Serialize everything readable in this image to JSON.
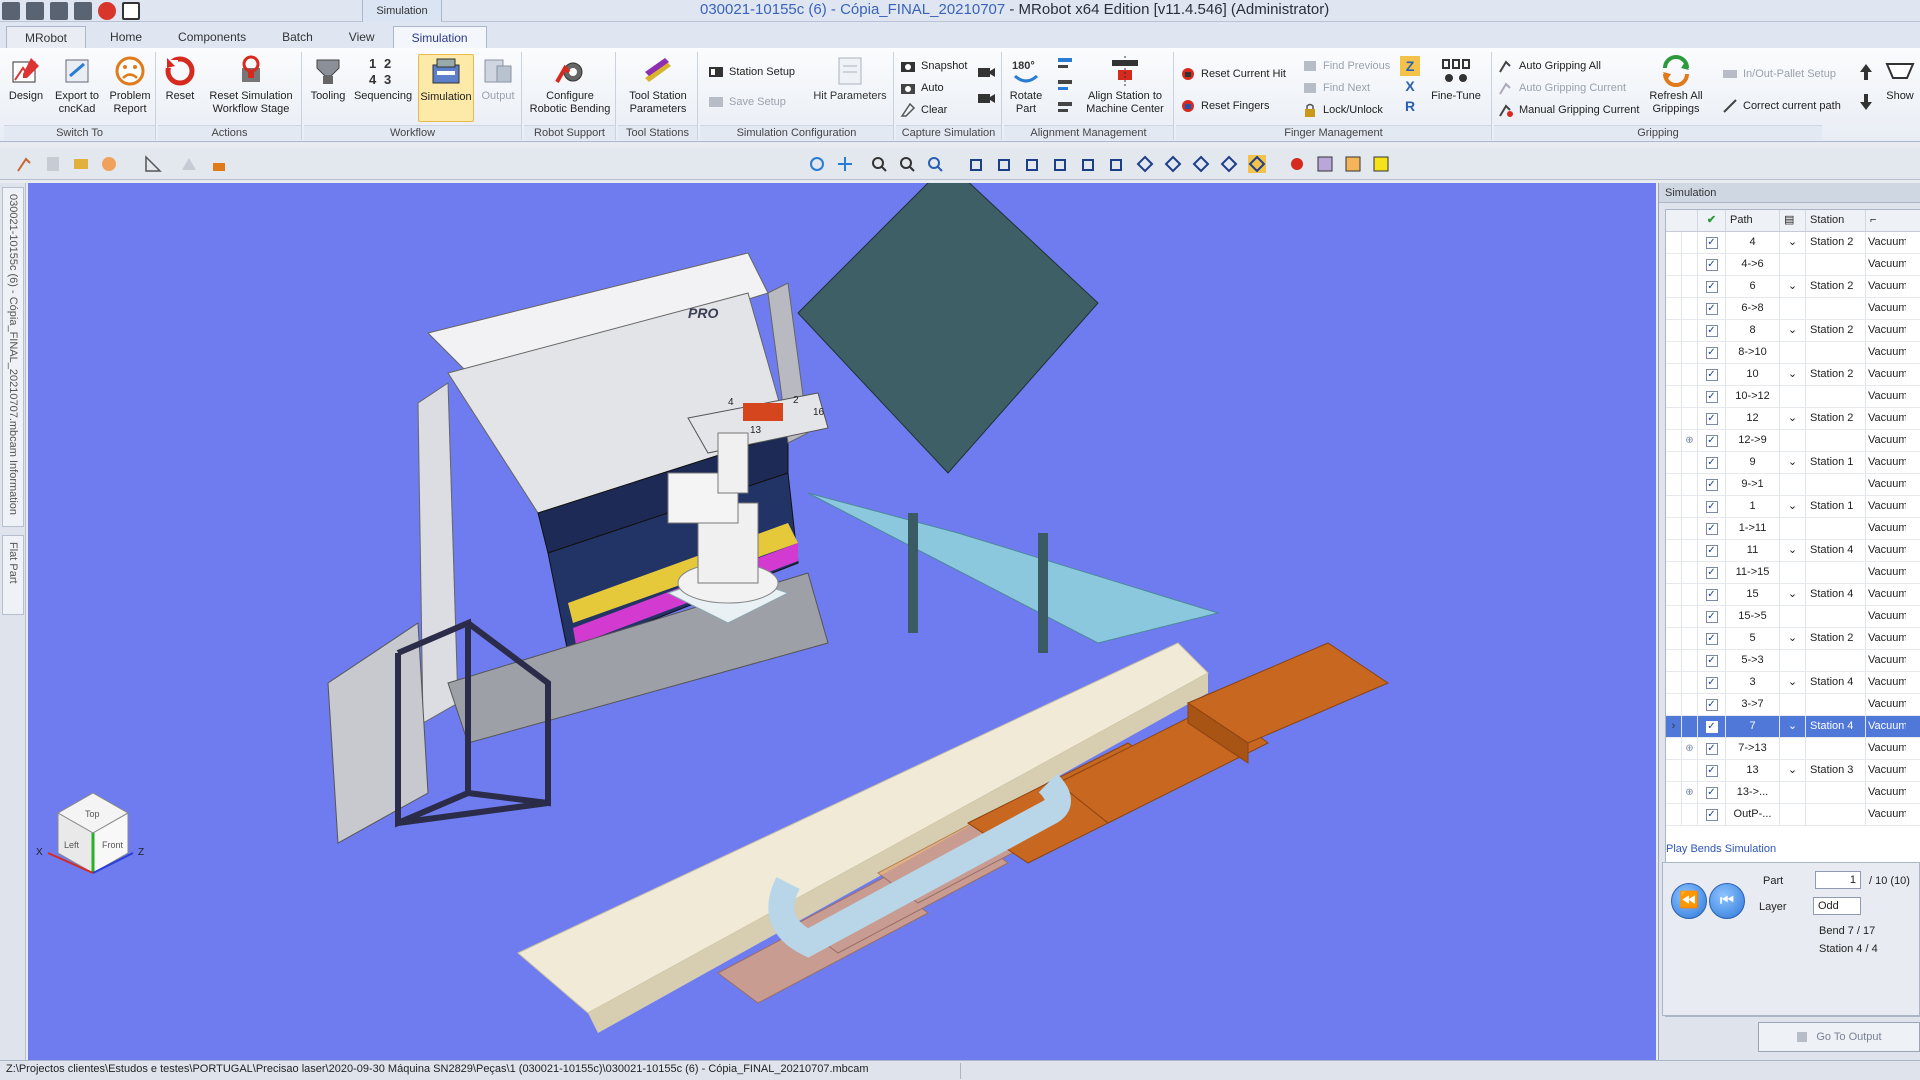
{
  "window": {
    "doc_name": "030021-10155c (6) - Cópia_FINAL_20210707",
    "app_name": " - MRobot x64 Edition [v11.4.546] (Administrator)",
    "context_tab_title": "Simulation"
  },
  "tabs": [
    "MRobot",
    "Home",
    "Components",
    "Batch",
    "View",
    "Simulation"
  ],
  "ribbon": {
    "switch_to": {
      "label": "Switch To",
      "design": "Design",
      "export": "Export to\ncncKad",
      "problem": "Problem\nReport"
    },
    "actions": {
      "label": "Actions",
      "reset": "Reset",
      "reset_stage": "Reset Simulation\nWorkflow Stage"
    },
    "workflow": {
      "label": "Workflow",
      "tooling": "Tooling",
      "sequencing": "Sequencing",
      "simulation": "Simulation",
      "output": "Output"
    },
    "robot_support": {
      "label": "Robot Support",
      "configure": "Configure\nRobotic Bending"
    },
    "tool_stations": {
      "label": "Tool Stations",
      "params": "Tool Station\nParameters"
    },
    "sim_config": {
      "label": "Simulation Configuration",
      "station_setup": "Station Setup",
      "save_setup": "Save Setup",
      "hit_params": "Hit Parameters"
    },
    "capture": {
      "label": "Capture Simulation",
      "snapshot": "Snapshot",
      "auto": "Auto",
      "clear": "Clear"
    },
    "alignment": {
      "label": "Alignment Management",
      "rotate": "Rotate\nPart",
      "align": "Align Station to\nMachine Center"
    },
    "finger": {
      "label": "Finger Management",
      "reset_hit": "Reset Current Hit",
      "reset_fingers": "Reset Fingers",
      "find_prev": "Find Previous",
      "find_next": "Find Next",
      "lock": "Lock/Unlock",
      "fine_tune": "Fine-Tune"
    },
    "gripping": {
      "label": "Gripping",
      "auto_all": "Auto Gripping All",
      "auto_current": "Auto Gripping Current",
      "manual_current": "Manual Gripping Current",
      "refresh_all": "Refresh All\nGrippings",
      "inout": "In/Out-Pallet Setup",
      "correct": "Correct current path",
      "show": "Show"
    }
  },
  "left_tabs": {
    "info": "030021-10155c (6) - Cópia_FINAL_20210707.mbcam Information",
    "flat": "Flat Part"
  },
  "viewport": {
    "brand": "PRO",
    "cube": {
      "top": "Top",
      "left": "Left",
      "front": "Front",
      "x": "X",
      "z": "Z"
    },
    "part_labels": [
      "4",
      "2",
      "13",
      "16"
    ]
  },
  "panel": {
    "title": "Simulation",
    "columns": {
      "path": "Path",
      "station": "Station"
    },
    "rows": [
      {
        "path": "4",
        "station": "Station 2",
        "tool": "Vacuum",
        "dd": true
      },
      {
        "path": "4->6",
        "station": "",
        "tool": "Vacuum",
        "dd": false
      },
      {
        "path": "6",
        "station": "Station 2",
        "tool": "Vacuum",
        "dd": true
      },
      {
        "path": "6->8",
        "station": "",
        "tool": "Vacuum",
        "dd": false
      },
      {
        "path": "8",
        "station": "Station 2",
        "tool": "Vacuum",
        "dd": true
      },
      {
        "path": "8->10",
        "station": "",
        "tool": "Vacuum",
        "dd": false
      },
      {
        "path": "10",
        "station": "Station 2",
        "tool": "Vacuum",
        "dd": true
      },
      {
        "path": "10->12",
        "station": "",
        "tool": "Vacuum",
        "dd": false
      },
      {
        "path": "12",
        "station": "Station 2",
        "tool": "Vacuum",
        "dd": true
      },
      {
        "path": "12->9",
        "station": "",
        "tool": "Vacuum",
        "dd": false,
        "expand": true
      },
      {
        "path": "9",
        "station": "Station 1",
        "tool": "Vacuum",
        "dd": true
      },
      {
        "path": "9->1",
        "station": "",
        "tool": "Vacuum",
        "dd": false
      },
      {
        "path": "1",
        "station": "Station 1",
        "tool": "Vacuum",
        "dd": true
      },
      {
        "path": "1->11",
        "station": "",
        "tool": "Vacuum",
        "dd": false
      },
      {
        "path": "11",
        "station": "Station 4",
        "tool": "Vacuum",
        "dd": true
      },
      {
        "path": "11->15",
        "station": "",
        "tool": "Vacuum",
        "dd": false
      },
      {
        "path": "15",
        "station": "Station 4",
        "tool": "Vacuum",
        "dd": true
      },
      {
        "path": "15->5",
        "station": "",
        "tool": "Vacuum",
        "dd": false
      },
      {
        "path": "5",
        "station": "Station 2",
        "tool": "Vacuum",
        "dd": true
      },
      {
        "path": "5->3",
        "station": "",
        "tool": "Vacuum",
        "dd": false
      },
      {
        "path": "3",
        "station": "Station 4",
        "tool": "Vacuum",
        "dd": true
      },
      {
        "path": "3->7",
        "station": "",
        "tool": "Vacuum",
        "dd": false
      },
      {
        "path": "7",
        "station": "Station 4",
        "tool": "Vacuum",
        "dd": true,
        "selected": true
      },
      {
        "path": "7->13",
        "station": "",
        "tool": "Vacuum",
        "dd": false,
        "expand": true
      },
      {
        "path": "13",
        "station": "Station 3",
        "tool": "Vacuum",
        "dd": true
      },
      {
        "path": "13->...",
        "station": "",
        "tool": "Vacuum",
        "dd": false,
        "expand": true
      },
      {
        "path": "OutP-...",
        "station": "",
        "tool": "Vacuum",
        "dd": false
      }
    ]
  },
  "play": {
    "title": "Play Bends Simulation",
    "part_label": "Part",
    "part_value": "1",
    "part_total": "/ 10 (10)",
    "layer_label": "Layer",
    "layer_value": "Odd",
    "bend": "Bend 7  / 17",
    "station": "Station 4 / 4",
    "goto": "Go To Output"
  },
  "status": {
    "path": "Z:\\Projectos clientes\\Estudos e testes\\PORTUGAL\\Precisao laser\\2020-09-30 Máquina SN2829\\Peças\\1 (030021-10155c)\\030021-10155c (6) - Cópia_FINAL_20210707.mbcam"
  },
  "colors": {
    "viewport_bg": "#6e7cf0",
    "selected_row": "#4f78d8",
    "accent_active": "#fde9a8"
  }
}
